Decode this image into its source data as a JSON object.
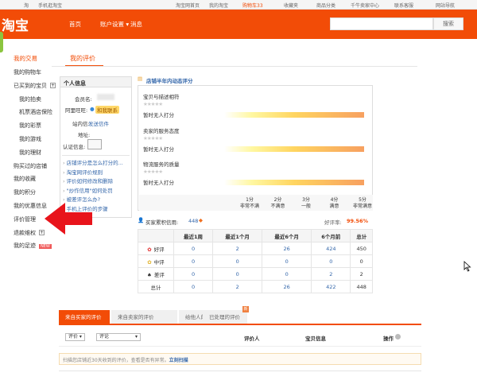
{
  "topbar": {
    "left": [
      "淘",
      "手机逛淘宝"
    ],
    "links": [
      "淘宝网首页",
      "我的淘宝",
      "购物车33",
      "收藏夹",
      "商品分类",
      "千牛卖家中心",
      "联系客服",
      "网站导航"
    ]
  },
  "header": {
    "logo": "淘宝",
    "nav": [
      "首页",
      "账户设置 ▾",
      "消息"
    ],
    "search_button": "搜索",
    "search_value": ""
  },
  "sidebar": {
    "title": "我的交易",
    "items": [
      {
        "label": "我的购物车",
        "level": 0
      },
      {
        "label": "已买到的宝贝",
        "level": 0,
        "expand": true
      },
      {
        "label": "我的拍卖",
        "level": 1
      },
      {
        "label": "机票酒店保险",
        "level": 1
      },
      {
        "label": "我的彩票",
        "level": 1
      },
      {
        "label": "我的游戏",
        "level": 1
      },
      {
        "label": "我的理财",
        "level": 1
      },
      {
        "label": "购买过的店铺",
        "level": 0
      },
      {
        "label": "我的收藏",
        "level": 0
      },
      {
        "label": "我的积分",
        "level": 0
      },
      {
        "label": "我的优惠信息",
        "level": 0
      },
      {
        "label": "评价管理",
        "level": 0
      },
      {
        "label": "退款维权",
        "level": 0,
        "expand": true
      },
      {
        "label": "我的足迹",
        "level": 0,
        "badge": "NEW"
      }
    ]
  },
  "main_tab": "我的评价",
  "personal": {
    "title": "个人信息",
    "member_label": "会员名:",
    "wangwang_label": "阿里旺旺:",
    "wangwang_badge": "和我联系",
    "msg_label": "站内信:",
    "msg_link": "发送信件",
    "addr_label": "地址:",
    "cert_label": "认证信息:",
    "links": [
      "店铺评分是怎么打分的...",
      "淘宝网评价规则",
      "评价如何修改和删除",
      "\"炒作信用\"如何处罚",
      "被差评怎么办?",
      "手机上评价的步骤"
    ]
  },
  "dsr": {
    "title": "店铺半年内动态评分",
    "items": [
      {
        "label": "宝贝与描述相符",
        "status": "暂时无人打分"
      },
      {
        "label": "卖家的服务态度",
        "status": "暂时无人打分"
      },
      {
        "label": "物流服务的质量",
        "status": "暂时无人打分"
      }
    ],
    "scale": [
      {
        "score": "1分",
        "desc": "非常不满"
      },
      {
        "score": "2分",
        "desc": "不满意"
      },
      {
        "score": "3分",
        "desc": "一般"
      },
      {
        "score": "4分",
        "desc": "满意"
      },
      {
        "score": "5分",
        "desc": "非常满意"
      }
    ]
  },
  "credit": {
    "label": "买家累积信用:",
    "value": "448",
    "rate_label": "好评率:",
    "rate": "99.56%",
    "headers": [
      "",
      "最近1周",
      "最近1个月",
      "最近6个月",
      "6个月前",
      "总计"
    ],
    "rows": [
      {
        "label": "好评",
        "icon": "flower-red-icon",
        "vals": [
          "0",
          "2",
          "26",
          "424",
          "450"
        ]
      },
      {
        "label": "中评",
        "icon": "flower-yellow-icon",
        "vals": [
          "0",
          "0",
          "0",
          "0",
          "0"
        ]
      },
      {
        "label": "差评",
        "icon": "withered-icon",
        "vals": [
          "0",
          "0",
          "0",
          "2",
          "2"
        ]
      },
      {
        "label": "总计",
        "vals": [
          "0",
          "2",
          "26",
          "422",
          "448"
        ]
      }
    ]
  },
  "review_tabs": [
    "来自买家的评价",
    "来自卖家的评价",
    "给他人的评价",
    "已处理的评价"
  ],
  "filters": {
    "rating": "评价 ▾",
    "comment": "评论",
    "col_reviewer": "评价人",
    "col_item": "宝贝信息",
    "col_action": "操作"
  },
  "notice": {
    "text": "扫描您店铺近30天收到的评价，查看是否有异常。",
    "link": "立刻扫描"
  },
  "colors": {
    "accent": "#f24c07",
    "link": "#3366aa"
  }
}
